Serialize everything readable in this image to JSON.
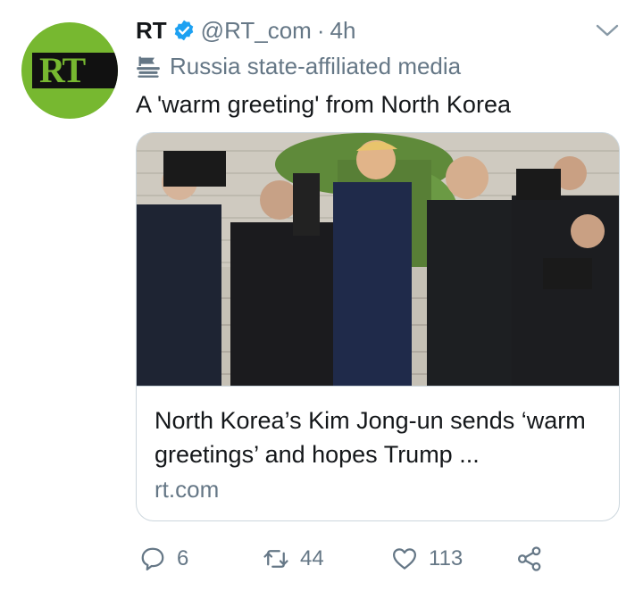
{
  "avatar": {
    "logo_text": "RT",
    "background": "#77b830"
  },
  "tweet": {
    "display_name": "RT",
    "handle": "@RT_com",
    "separator": "·",
    "time": "4h",
    "affiliation": "Russia state-affiliated media",
    "text": "A 'warm greeting' from North Korea"
  },
  "card": {
    "title": "North Korea’s Kim Jong-un sends ‘warm greetings’ and hopes Trump ...",
    "domain": "rt.com"
  },
  "actions": {
    "replies": "6",
    "retweets": "44",
    "likes": "113"
  },
  "icons": [
    "verified-icon",
    "chevron-down-icon",
    "affiliation-flag-icon",
    "reply-icon",
    "retweet-icon",
    "like-icon",
    "share-icon"
  ],
  "colors": {
    "verified": "#1da1f2",
    "muted": "#657786",
    "border": "#ccd6dd"
  }
}
